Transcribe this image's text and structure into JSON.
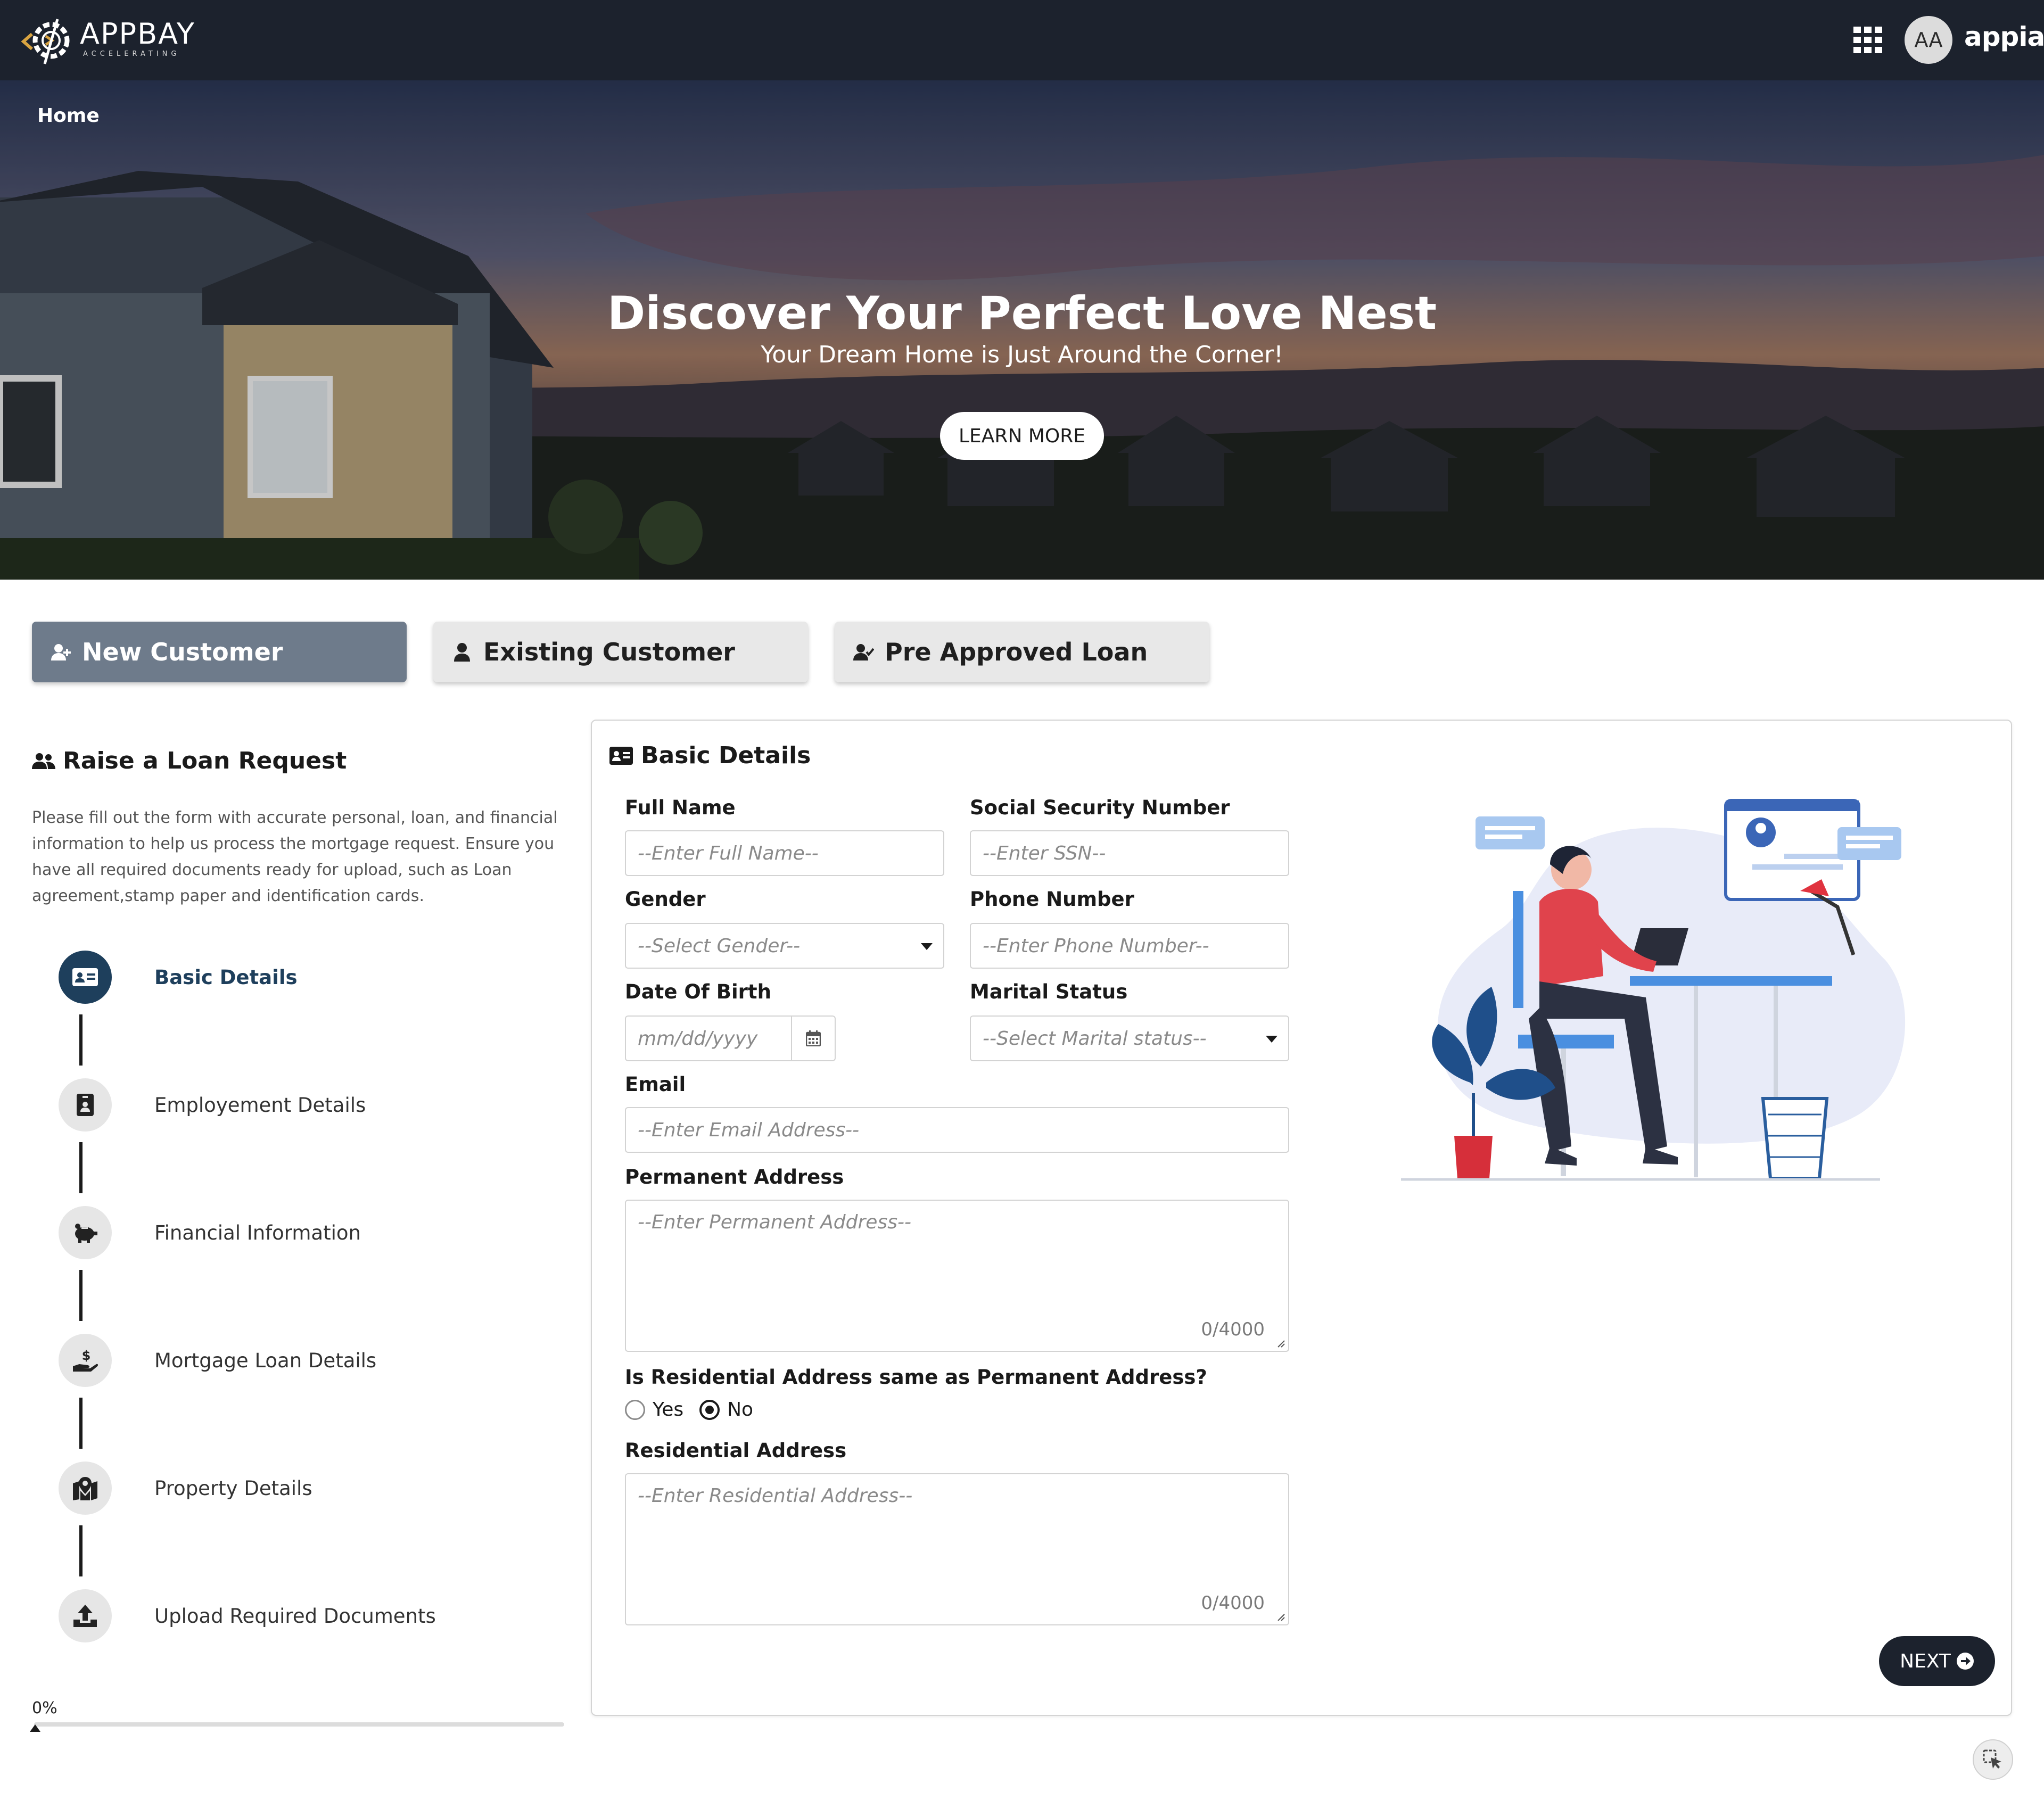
{
  "header": {
    "logo_text": "APPBAY",
    "logo_tagline": "ACCELERATING",
    "avatar_initials": "AA",
    "brand": "appian",
    "colors": {
      "bar": "#1c222d"
    }
  },
  "hero": {
    "breadcrumb": "Home",
    "title": "Discover Your Perfect Love Nest",
    "subtitle": "Your Dream Home is Just Around the Corner!",
    "cta": "LEARN MORE"
  },
  "tabs": [
    {
      "label": "New Customer",
      "icon": "user-plus-icon",
      "active": true
    },
    {
      "label": "Existing Customer",
      "icon": "user-icon",
      "active": false
    },
    {
      "label": "Pre Approved Loan",
      "icon": "user-check-icon",
      "active": false
    }
  ],
  "left_panel": {
    "title": "Raise a Loan Request",
    "description": "Please fill out the form with accurate personal, loan, and financial information to help us process the mortgage request. Ensure you have all required documents ready for upload, such as Loan agreement,stamp paper and identification cards.",
    "steps": [
      {
        "label": "Basic Details",
        "icon": "id-card-icon",
        "active": true
      },
      {
        "label": "Employement Details",
        "icon": "id-badge-icon",
        "active": false
      },
      {
        "label": "Financial Information",
        "icon": "piggy-bank-icon",
        "active": false
      },
      {
        "label": "Mortgage Loan Details",
        "icon": "hand-dollar-icon",
        "active": false
      },
      {
        "label": "Property Details",
        "icon": "map-marker-icon",
        "active": false
      },
      {
        "label": "Upload Required Documents",
        "icon": "upload-icon",
        "active": false
      }
    ],
    "progress_label": "0%",
    "progress_value": 0
  },
  "form": {
    "title": "Basic Details",
    "full_name": {
      "label": "Full Name",
      "placeholder": "--Enter Full Name--",
      "value": ""
    },
    "ssn": {
      "label": "Social Security Number",
      "placeholder": "--Enter SSN--",
      "value": ""
    },
    "gender": {
      "label": "Gender",
      "placeholder": "--Select Gender--"
    },
    "phone": {
      "label": "Phone Number",
      "placeholder": "--Enter Phone Number--",
      "value": ""
    },
    "dob": {
      "label": "Date Of Birth",
      "placeholder": "mm/dd/yyyy"
    },
    "marital": {
      "label": "Marital Status",
      "placeholder": "--Select Marital status--"
    },
    "email": {
      "label": "Email",
      "placeholder": "--Enter Email Address--",
      "value": ""
    },
    "permanent_address": {
      "label": "Permanent Address",
      "placeholder": "--Enter Permanent Address--",
      "counter": "0/4000"
    },
    "same_address": {
      "question": "Is Residential Address same as Permanent Address?",
      "options": [
        "Yes",
        "No"
      ],
      "selected": "No"
    },
    "residential_address": {
      "label": "Residential Address",
      "placeholder": "--Enter Residential Address--",
      "counter": "0/4000"
    },
    "next": "NEXT"
  }
}
